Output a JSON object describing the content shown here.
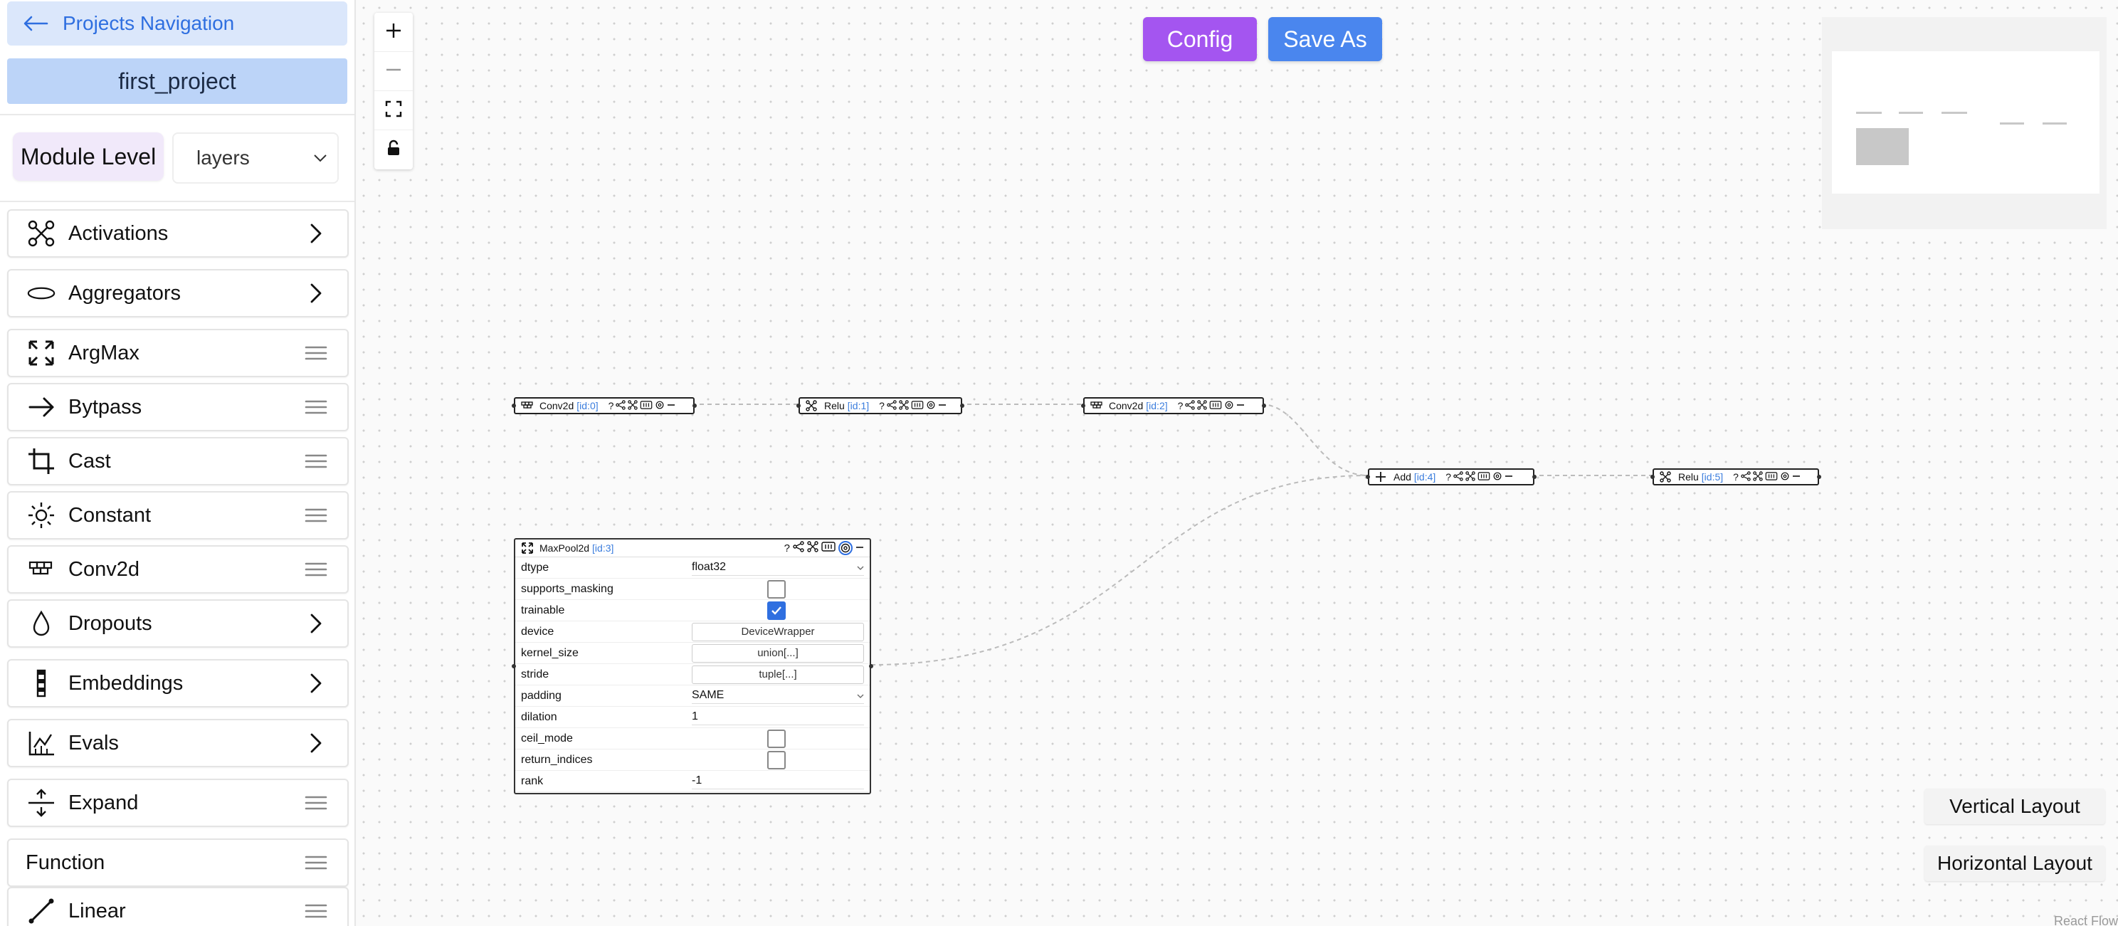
{
  "sidebar": {
    "nav_label": "Projects Navigation",
    "project_name": "first_project",
    "module_level_label": "Module Level",
    "layer_select": {
      "value": "layers"
    },
    "items": [
      {
        "label": "Activations",
        "icon": "activations-icon",
        "trail": "chevron"
      },
      {
        "label": "Aggregators",
        "icon": "ellipse-icon",
        "trail": "chevron"
      },
      {
        "label": "ArgMax",
        "icon": "expand-arrows-icon",
        "trail": "drag"
      },
      {
        "label": "Bytpass",
        "icon": "arrow-right-icon",
        "trail": "drag"
      },
      {
        "label": "Cast",
        "icon": "crop-icon",
        "trail": "drag"
      },
      {
        "label": "Constant",
        "icon": "sun-icon",
        "trail": "drag"
      },
      {
        "label": "Conv2d",
        "icon": "conv-icon",
        "trail": "drag"
      },
      {
        "label": "Dropouts",
        "icon": "drop-icon",
        "trail": "chevron"
      },
      {
        "label": "Embeddings",
        "icon": "embeddings-icon",
        "trail": "chevron"
      },
      {
        "label": "Evals",
        "icon": "chart-icon",
        "trail": "chevron"
      },
      {
        "label": "Expand",
        "icon": "expand-vertical-icon",
        "trail": "drag"
      },
      {
        "label": "Function",
        "icon": "",
        "trail": "drag"
      },
      {
        "label": "Linear",
        "icon": "line-icon",
        "trail": "drag"
      }
    ]
  },
  "toolbar": {
    "config_label": "Config",
    "save_as_label": "Save As"
  },
  "colors": {
    "config": "#a455f0",
    "save_as": "#4a86ee",
    "accent": "#2f6fe0"
  },
  "nodes": [
    {
      "name": "Conv2d",
      "id": "[id:0]"
    },
    {
      "name": "Relu",
      "id": "[id:1]"
    },
    {
      "name": "Conv2d",
      "id": "[id:2]"
    },
    {
      "name": "Add",
      "id": "[id:4]"
    },
    {
      "name": "Relu",
      "id": "[id:5]"
    }
  ],
  "maxpool": {
    "name": "MaxPool2d",
    "id": "[id:3]",
    "params": [
      {
        "key": "dtype",
        "type": "select",
        "value": "float32"
      },
      {
        "key": "supports_masking",
        "type": "checkbox",
        "checked": false
      },
      {
        "key": "trainable",
        "type": "checkbox",
        "checked": true
      },
      {
        "key": "device",
        "type": "button",
        "value": "DeviceWrapper"
      },
      {
        "key": "kernel_size",
        "type": "button",
        "value": "union[...]"
      },
      {
        "key": "stride",
        "type": "button",
        "value": "tuple[...]"
      },
      {
        "key": "padding",
        "type": "select",
        "value": "SAME"
      },
      {
        "key": "dilation",
        "type": "text",
        "value": "1"
      },
      {
        "key": "ceil_mode",
        "type": "checkbox",
        "checked": false
      },
      {
        "key": "return_indices",
        "type": "checkbox",
        "checked": false
      },
      {
        "key": "rank",
        "type": "text",
        "value": "-1"
      }
    ]
  },
  "layout_buttons": {
    "vertical": "Vertical Layout",
    "horizontal": "Horizontal Layout"
  },
  "attribution": "React Flow"
}
